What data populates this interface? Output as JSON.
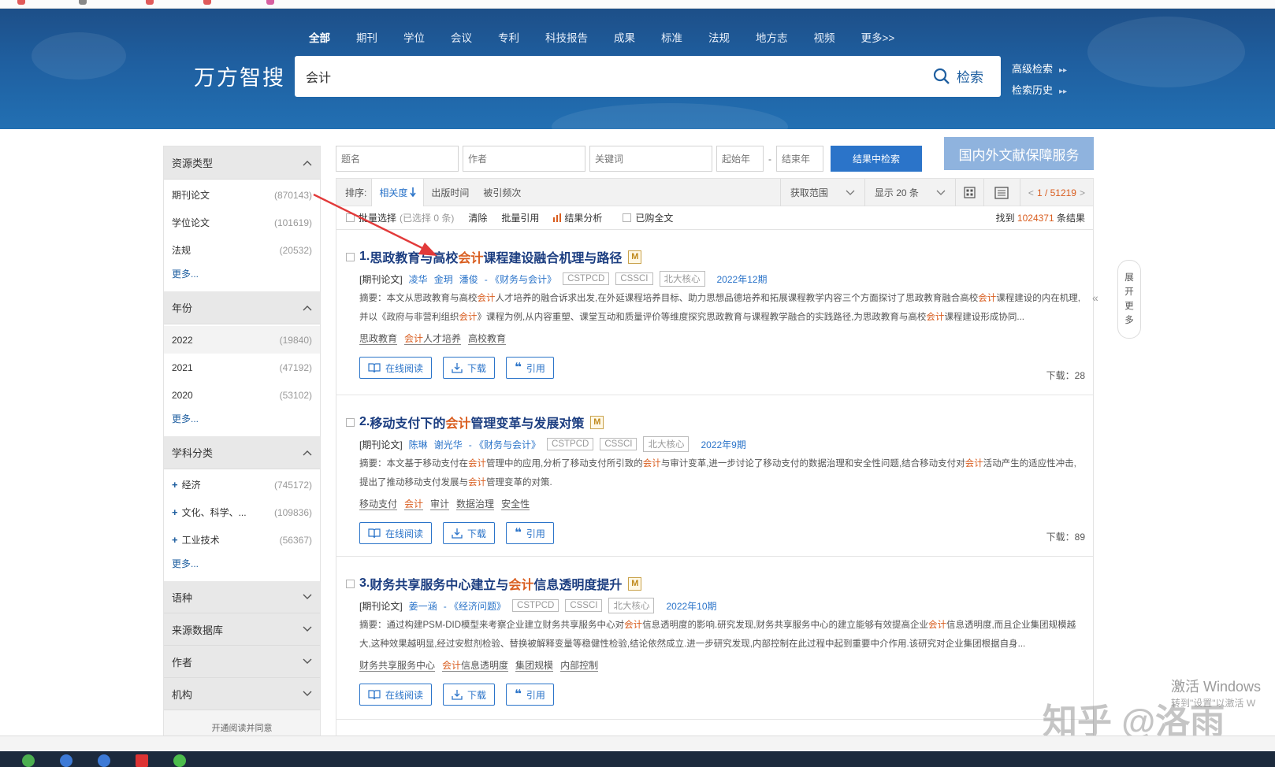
{
  "site": {
    "logo": "万方智搜",
    "nav": [
      "全部",
      "期刊",
      "学位",
      "会议",
      "专利",
      "科技报告",
      "成果",
      "标准",
      "法规",
      "地方志",
      "视频",
      "更多>>"
    ],
    "search_value": "会计",
    "search_button": "检索",
    "advanced_search": "高级检索",
    "search_history": "检索历史",
    "arrow_glyph": "▸▸"
  },
  "sidebar": {
    "sections": [
      {
        "title": "资源类型",
        "items": [
          {
            "label": "期刊论文",
            "count": "(870143)"
          },
          {
            "label": "学位论文",
            "count": "(101619)"
          },
          {
            "label": "法规",
            "count": "(20532)"
          }
        ],
        "more": "更多..."
      },
      {
        "title": "年份",
        "items": [
          {
            "label": "2022",
            "count": "(19840)"
          },
          {
            "label": "2021",
            "count": "(47192)"
          },
          {
            "label": "2020",
            "count": "(53102)"
          }
        ],
        "more": "更多..."
      },
      {
        "title": "学科分类",
        "items": [
          {
            "label": "经济",
            "count": "(745172)"
          },
          {
            "label": "文化、科学、...",
            "count": "(109836)"
          },
          {
            "label": "工业技术",
            "count": "(56367)"
          }
        ],
        "more": "更多..."
      }
    ],
    "collapsed": [
      "语种",
      "来源数据库",
      "作者",
      "机构"
    ],
    "footer": "开通阅读并同意"
  },
  "filters": {
    "title_ph": "题名",
    "author_ph": "作者",
    "keyword_ph": "关键词",
    "start_year_ph": "起始年",
    "dash": "-",
    "end_year_ph": "结束年",
    "search_in_results": "结果中检索",
    "service": "国内外文献保障服务"
  },
  "sortbar": {
    "label": "排序:",
    "relevance": "相关度",
    "pub_time": "出版时间",
    "cited": "被引频次",
    "scope": "获取范围",
    "show": "显示 20 条",
    "page_prefix": "<",
    "page": "1 / 51219",
    "page_suffix": ">"
  },
  "toolbar": {
    "batch": "批量选择",
    "selected": "(已选择 0 条)",
    "clear": "清除",
    "batch_cite": "批量引用",
    "analysis": "结果分析",
    "purchased": "已购全文",
    "found_prefix": "找到",
    "found_count": "1024371",
    "found_suffix": "条结果"
  },
  "results": [
    {
      "num": "1.",
      "title_a": "思政教育与高校",
      "title_hl": "会计",
      "title_b": "课程建设融合机理与路径",
      "type": "[期刊论文]",
      "authors": [
        "凌华",
        "金玥",
        "潘俊"
      ],
      "journal": "- 《财务与会计》",
      "tags": [
        "CSTPCD",
        "CSSCI",
        "北大核心"
      ],
      "date": "2022年12期",
      "abstract": "摘要：本文从思政教育与高校会计人才培养的融合诉求出发,在外延课程培养目标、助力思想品德培养和拓展课程教学内容三个方面探讨了思政教育融合高校会计课程建设的内在机理,并以《政府与非营利组织会计》课程为例,从内容重塑、课堂互动和质量评价等维度探究思政教育与课程教学融合的实践路径,为思政教育与高校会计课程建设形成协同...",
      "keywords": [
        "思政教育",
        "会计人才培养",
        "高校教育"
      ],
      "downloads": "下载：28"
    },
    {
      "num": "2.",
      "title_a": "移动支付下的",
      "title_hl": "会计",
      "title_b": "管理变革与发展对策",
      "type": "[期刊论文]",
      "authors": [
        "陈琳",
        "谢光华"
      ],
      "journal": "- 《财务与会计》",
      "tags": [
        "CSTPCD",
        "CSSCI",
        "北大核心"
      ],
      "date": "2022年9期",
      "abstract": "摘要：本文基于移动支付在会计管理中的应用,分析了移动支付所引致的会计与审计变革,进一步讨论了移动支付的数据治理和安全性问题,结合移动支付对会计活动产生的适应性冲击,提出了推动移动支付发展与会计管理变革的对策.",
      "keywords": [
        "移动支付",
        "会计",
        "审计",
        "数据治理",
        "安全性"
      ],
      "downloads": "下载：89"
    },
    {
      "num": "3.",
      "title_a": "财务共享服务中心建立与",
      "title_hl": "会计",
      "title_b": "信息透明度提升",
      "type": "[期刊论文]",
      "authors": [
        "姜一涵"
      ],
      "journal": "- 《经济问题》",
      "tags": [
        "CSTPCD",
        "CSSCI",
        "北大核心"
      ],
      "date": "2022年10期",
      "abstract": "摘要：通过构建PSM-DID模型来考察企业建立财务共享服务中心对会计信息透明度的影响.研究发现,财务共享服务中心的建立能够有效提高企业会计信息透明度,而且企业集团规模越大,这种效果越明显,经过安慰剂检验、替换被解释变量等稳健性检验,结论依然成立.进一步研究发现,内部控制在此过程中起到重要中介作用.该研究对企业集团根据自身...",
      "keywords": [
        "财务共享服务中心",
        "会计信息透明度",
        "集团规模",
        "内部控制"
      ],
      "downloads": ""
    }
  ],
  "actions": {
    "read": "在线阅读",
    "download": "下载",
    "cite": "引用"
  },
  "expand": [
    "展",
    "开",
    "更",
    "多"
  ],
  "expand_arrow": "«",
  "watermark": "知乎 @洛雨",
  "activate_windows": "激活 Windows",
  "activate_sub": "转到\"设置\"以激活 W",
  "colors": {
    "brand": "#1f5fa0",
    "highlight": "#d95d1f",
    "link": "#2b74c9"
  }
}
